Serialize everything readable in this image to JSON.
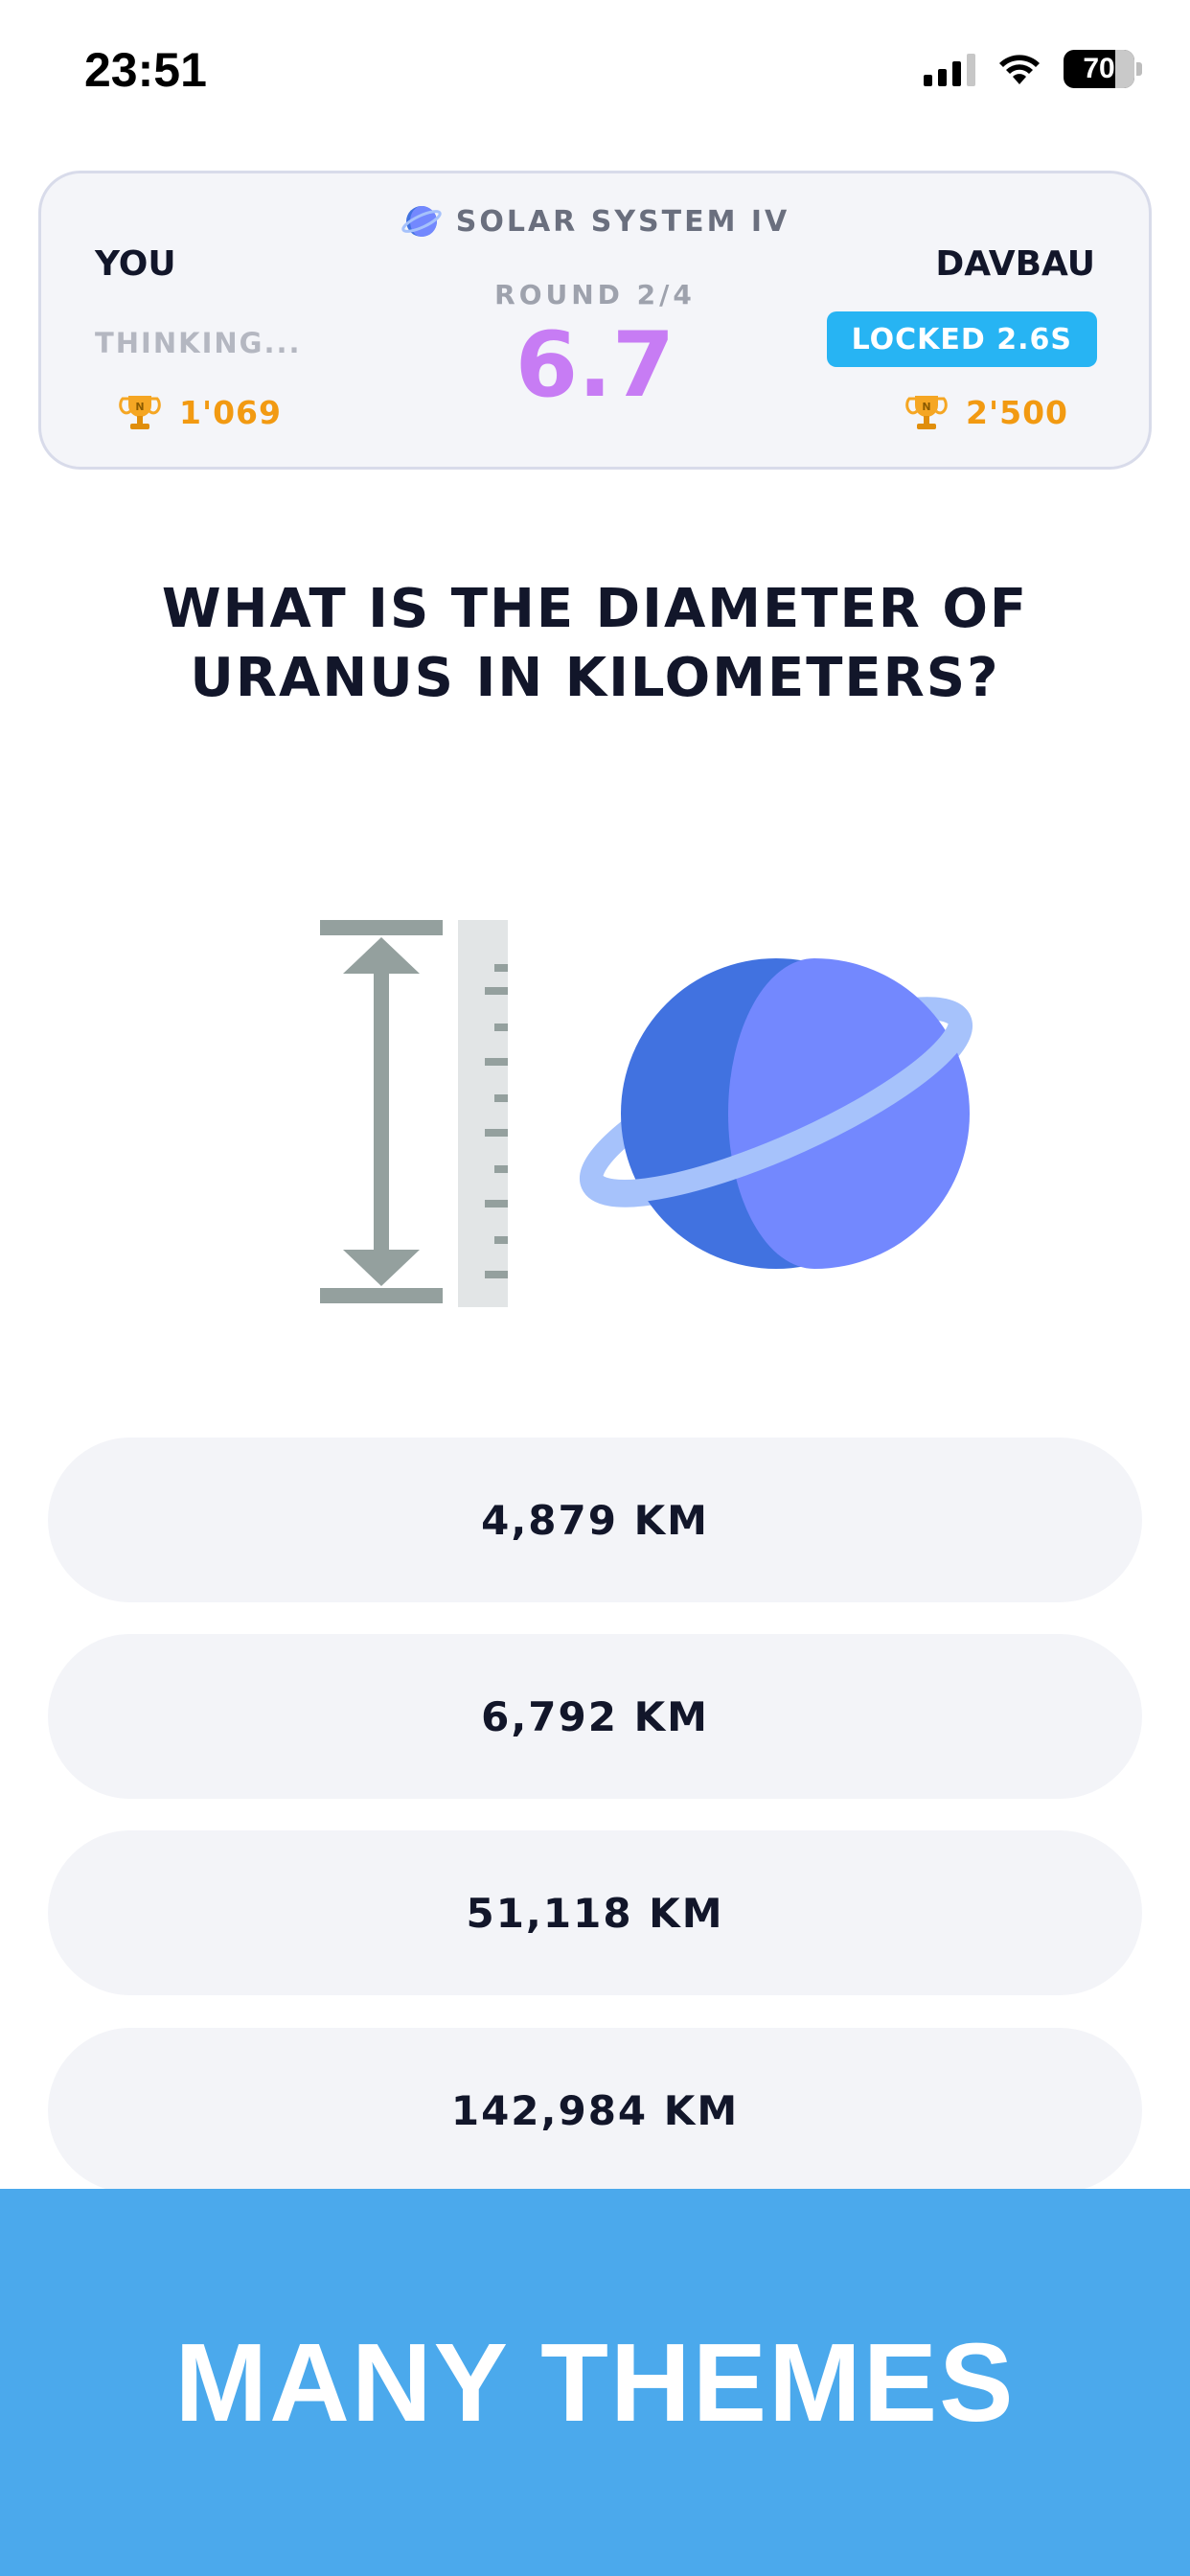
{
  "status_bar": {
    "time": "23:51",
    "battery": "70"
  },
  "game": {
    "topic": "SOLAR SYSTEM IV",
    "player": {
      "name": "YOU",
      "status": "THINKING...",
      "trophies": "1'069"
    },
    "opponent": {
      "name": "DAVBAU",
      "status": "LOCKED 2.6S",
      "trophies": "2'500"
    },
    "round": "ROUND 2/4",
    "timer": "6.7"
  },
  "question": "WHAT IS THE DIAMETER OF URANUS IN KILOMETERS?",
  "answers": [
    "4,879 KM",
    "6,792 KM",
    "51,118 KM",
    "142,984 KM"
  ],
  "banner": {
    "text": "MANY THEMES"
  },
  "colors": {
    "accent_timer": "#c77cf4",
    "badge_blue": "#27b4f3",
    "trophy_orange": "#f29a12",
    "banner_blue": "#4ba9ec",
    "planet_dark": "#4172e0",
    "planet_light": "#7388fe",
    "ring": "#a6c2fb"
  },
  "icons": {
    "topic": "planet-icon",
    "trophy": "trophy-icon",
    "illustration": "diameter-ruler-planet"
  }
}
